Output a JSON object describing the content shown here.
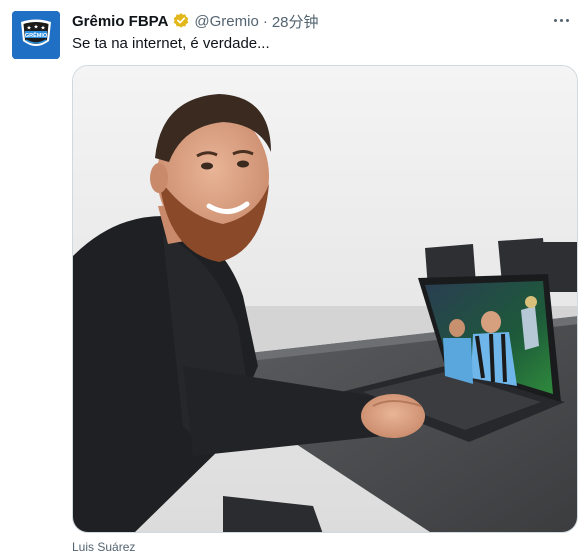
{
  "tweet": {
    "display_name": "Grêmio FBPA",
    "handle": "@Gremio",
    "separator": "·",
    "time": "28分钟",
    "text": "Se ta na internet, é verdade...",
    "media_caption": "Luis Suárez",
    "avatar_label": "GRÊMIO"
  },
  "icons": {
    "verified": "verified-badge-icon",
    "more": "more-options-icon",
    "avatar": "gremio-crest-avatar"
  },
  "colors": {
    "name_text": "#0f1419",
    "secondary_text": "#536471",
    "verified_gold": "#e2b719",
    "avatar_blue": "#1f6fc4",
    "media_border": "#cfd9de"
  }
}
